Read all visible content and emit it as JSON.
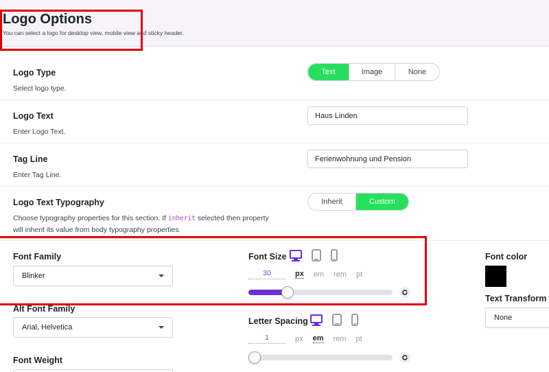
{
  "header": {
    "title": "Logo Options",
    "subtitle": "You can select a logo for desktop view, mobile view and sticky header."
  },
  "logo_type": {
    "label": "Logo Type",
    "description": "Select logo type.",
    "options": [
      "Text",
      "Image",
      "None"
    ],
    "selected": "Text"
  },
  "logo_text": {
    "label": "Logo Text",
    "description": "Enter Logo Text.",
    "value": "Haus Linden"
  },
  "tag_line": {
    "label": "Tag Line",
    "description": "Enter Tag Line.",
    "value": "Ferienwohnung und Pension"
  },
  "typography": {
    "label": "Logo Text Typography",
    "description_before": "Choose typography properties for this section. If",
    "description_code": "inherit",
    "description_after": "selected then property",
    "description_line2": "will inherit its value from body typography properties.",
    "options": [
      "Inherit",
      "Custom"
    ],
    "selected": "Custom"
  },
  "font_family": {
    "label": "Font Family",
    "value": "Blinker"
  },
  "alt_font_family": {
    "label": "Alt Font Family",
    "value": "Arial, Helvetica"
  },
  "font_weight": {
    "label": "Font Weight"
  },
  "font_size": {
    "label": "Font Size",
    "value": "30",
    "units": [
      "px",
      "em",
      "rem",
      "pt"
    ],
    "active_unit": "px",
    "slider_fraction": 0.27
  },
  "letter_spacing": {
    "label": "Letter Spacing",
    "value": "1",
    "units": [
      "px",
      "em",
      "rem",
      "pt"
    ],
    "active_unit": "em",
    "slider_fraction": 0.0
  },
  "font_color": {
    "label": "Font color",
    "color": "#000000"
  },
  "text_transform": {
    "label": "Text Transform",
    "value": "None"
  },
  "icons": {
    "desktop": "desktop-icon",
    "tablet": "tablet-icon",
    "mobile": "mobile-icon",
    "reset": "reset-icon",
    "dropdown": "chevron-down-icon"
  },
  "colors": {
    "accent_green": "#26e05d",
    "accent_purple": "#6a2fd6",
    "highlight_red": "#e00000"
  }
}
